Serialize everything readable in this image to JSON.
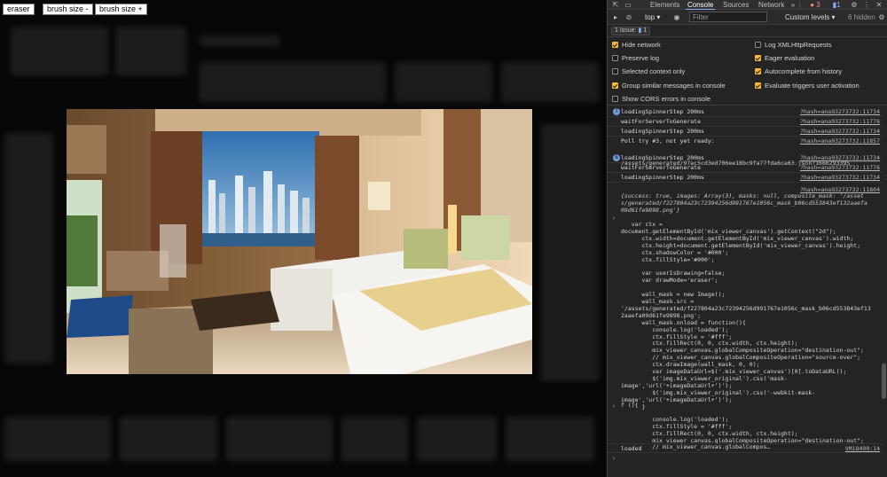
{
  "page": {
    "buttons": [
      {
        "id": "eraser",
        "label": "eraser"
      },
      {
        "id": "brush-minus",
        "label": "brush size -"
      },
      {
        "id": "brush-plus",
        "label": "brush size +"
      }
    ]
  },
  "devtools": {
    "tabs": [
      "Elements",
      "Console",
      "Sources",
      "Network"
    ],
    "active_tab": "Console",
    "error_count": "3",
    "info_count": "1",
    "toolbar": {
      "context": "top",
      "filter_placeholder": "Filter",
      "levels": "Custom levels",
      "hidden": "6 hidden"
    },
    "issues": {
      "label": "1 Issue:",
      "count": "1"
    },
    "settings_left": [
      {
        "label": "Hide network",
        "checked": true
      },
      {
        "label": "Preserve log",
        "checked": false
      },
      {
        "label": "Selected context only",
        "checked": false
      },
      {
        "label": "Group similar messages in console",
        "checked": true
      },
      {
        "label": "Show CORS errors in console",
        "checked": false
      }
    ],
    "settings_right": [
      {
        "label": "Log XMLHttpRequests",
        "checked": false
      },
      {
        "label": "Eager evaluation",
        "checked": true
      },
      {
        "label": "Autocomplete from history",
        "checked": true
      },
      {
        "label": "Evaluate triggers user activation",
        "checked": true
      }
    ],
    "logs": [
      {
        "count": "7",
        "msg": "loadingSpinnerStep 200ms",
        "src": "?hash=ana93273732:11734"
      },
      {
        "count": "",
        "msg": "waitForServerToGenerate",
        "src": "?hash=ana93273732:11776"
      },
      {
        "count": "",
        "msg": "loadingSpinnerStep 200ms",
        "src": "?hash=ana93273732:11734"
      },
      {
        "count": "",
        "msg": "Poll try #3, not yet ready:",
        "src": "?hash=ana93273732:11857"
      },
      {
        "count": "8",
        "msg": "loadingSpinnerStep 200ms",
        "src": "?hash=ana93273732:11734"
      },
      {
        "count": "",
        "msg": "waitForServerToGenerate",
        "src": "?hash=ana93273732:11776"
      },
      {
        "count": "",
        "msg": "loadingSpinnerStep 200ms",
        "src": "?hash=ana93273732:11734"
      }
    ],
    "poll_path": "/assets/generated/97ac5cd3ed706ee18bc9fa77fda6ca63.json?1666293395",
    "last_src": "?hash=ana93273732:11804",
    "result_object": [
      "{success: true, images: Array(3), masks: null, composite_mask: '/asset",
      "s/generated/f227804a23c72394256d991767e1056c_mask_b06cd553843ef132aaefa",
      "09d61fe9898.png'}"
    ],
    "code_block": [
      "   var ctx =",
      "document.getElementById('mix_viewer_canvas').getContext(\"2d\");",
      "      ctx.width=document.getElementById('mix_viewer_canvas').width;",
      "      ctx.height=document.getElementById('mix_viewer_canvas').height;",
      "      ctx.shadowColor = '#000';",
      "      ctx.fillStyle='#000';",
      "",
      "      var userIsDrawing=false;",
      "      var drawMode='eraser';",
      "",
      "      wall_mask = new Image();",
      "      wall_mask.src =",
      "'/assets/generated/f227804a23c72394256d991767e1056c_mask_b06cd553843ef13",
      "2aaefa09d61fe9898.png';",
      "      wall_mask.onload = function(){",
      "         console.log('loaded');",
      "         ctx.fillStyle = '#fff';",
      "         ctx.fillRect(0, 0, ctx.width, ctx.height);",
      "         mix_viewer_canvas.globalCompositeOperation=\"destination-out\";",
      "         // mix_viewer_canvas.globalCompositeOperation=\"source-over\";",
      "         ctx.drawImage(wall_mask, 0, 0);",
      "         var imageDataUrl=$('.mix_viewer_canvas')[0].toDataURL();",
      "         $('img.mix_viewer_original').css('mask-",
      "image','url('+imageDataUrl+')');",
      "         $('img.mix_viewer_original').css('-webkit-mask-",
      "image','url('+imageDataUrl+')');",
      "      }"
    ],
    "return_block": [
      "f (){",
      "",
      "         console.log('loaded');",
      "         ctx.fillStyle = '#fff';",
      "         ctx.fillRect(0, 0, ctx.width, ctx.height);",
      "         mix_viewer_canvas.globalCompositeOperation=\"destination-out\";",
      "         // mix_viewer_canvas.globalCompos…"
    ],
    "final_log": {
      "msg": "loaded",
      "src": "VM18490:14"
    }
  },
  "colors": {
    "accent": "#8ab4f8",
    "checkbox_on": "#f6b73c",
    "error": "#f28b82"
  }
}
